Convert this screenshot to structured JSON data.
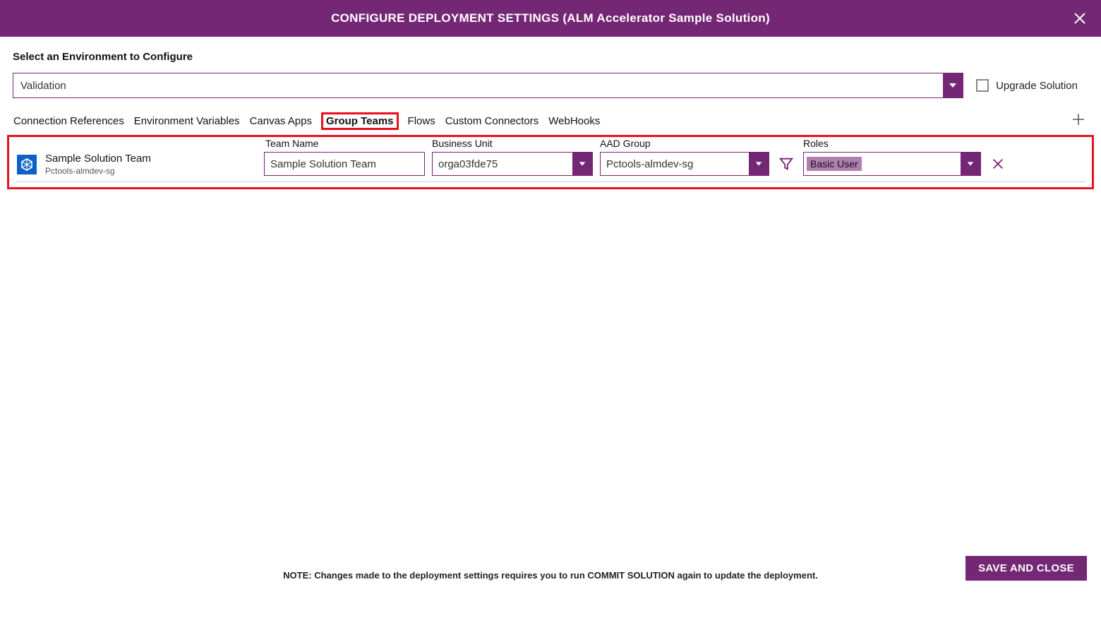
{
  "header": {
    "title": "CONFIGURE DEPLOYMENT SETTINGS (ALM Accelerator Sample Solution)"
  },
  "env": {
    "label": "Select an Environment to Configure",
    "selected": "Validation",
    "upgrade_label": "Upgrade Solution"
  },
  "tabs": [
    "Connection References",
    "Environment Variables",
    "Canvas Apps",
    "Group Teams",
    "Flows",
    "Custom Connectors",
    "WebHooks"
  ],
  "active_tab_index": 3,
  "columns": {
    "team_name": "Team Name",
    "business_unit": "Business Unit",
    "aad_group": "AAD Group",
    "roles": "Roles"
  },
  "row": {
    "title": "Sample Solution Team",
    "subtitle": "Pctools-almdev-sg",
    "team_name": "Sample Solution Team",
    "business_unit": "orga03fde75",
    "aad_group": "Pctools-almdev-sg",
    "role": "Basic User"
  },
  "footer_note": "NOTE: Changes made to the deployment settings requires you to run COMMIT SOLUTION again to update the deployment.",
  "save_button": "SAVE AND CLOSE"
}
